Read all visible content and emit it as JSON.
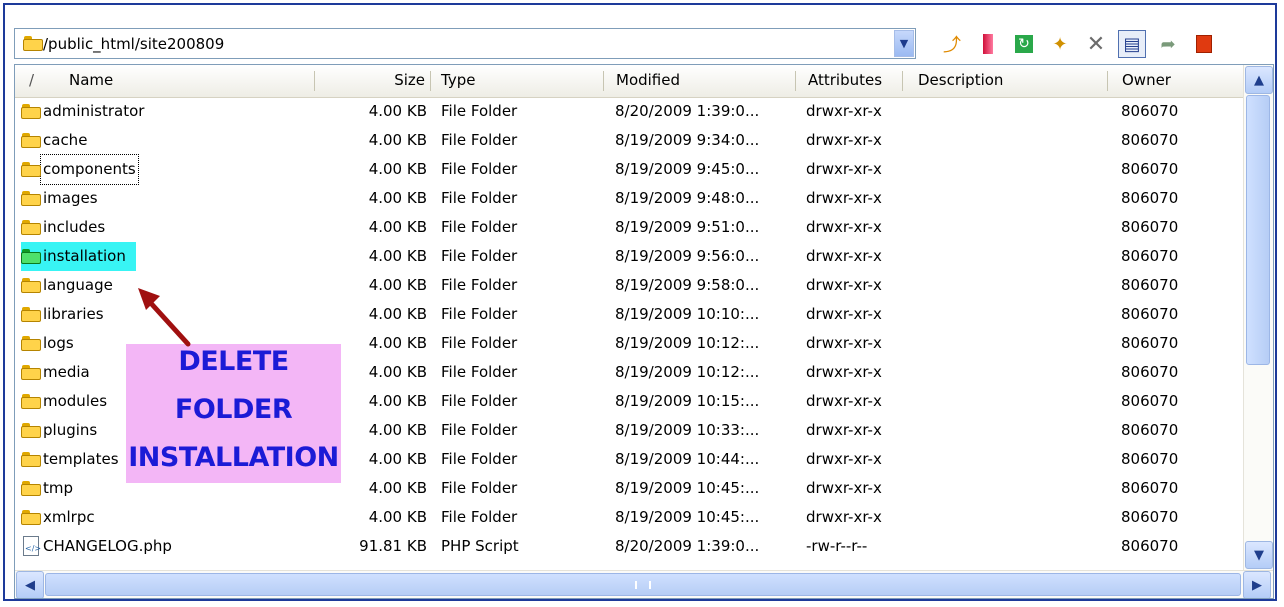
{
  "address": {
    "path": "/public_html/site200809"
  },
  "toolbar": {
    "icons": [
      "up-folder-icon",
      "bookmark-icon",
      "refresh-icon",
      "rename-icon",
      "delete-icon",
      "details-view-icon",
      "move-icon",
      "properties-icon"
    ]
  },
  "columns": {
    "sort_glyph": "/",
    "name": "Name",
    "size": "Size",
    "type": "Type",
    "modified": "Modified",
    "attributes": "Attributes",
    "description": "Description",
    "owner": "Owner"
  },
  "rows": [
    {
      "name": "administrator",
      "size": "4.00 KB",
      "type": "File Folder",
      "modified": "8/20/2009 1:39:0...",
      "attr": "drwxr-xr-x",
      "owner": "806070"
    },
    {
      "name": "cache",
      "size": "4.00 KB",
      "type": "File Folder",
      "modified": "8/19/2009 9:34:0...",
      "attr": "drwxr-xr-x",
      "owner": "806070"
    },
    {
      "name": "components",
      "size": "4.00 KB",
      "type": "File Folder",
      "modified": "8/19/2009 9:45:0...",
      "attr": "drwxr-xr-x",
      "owner": "806070"
    },
    {
      "name": "images",
      "size": "4.00 KB",
      "type": "File Folder",
      "modified": "8/19/2009 9:48:0...",
      "attr": "drwxr-xr-x",
      "owner": "806070"
    },
    {
      "name": "includes",
      "size": "4.00 KB",
      "type": "File Folder",
      "modified": "8/19/2009 9:51:0...",
      "attr": "drwxr-xr-x",
      "owner": "806070"
    },
    {
      "name": "installation",
      "size": "4.00 KB",
      "type": "File Folder",
      "modified": "8/19/2009 9:56:0...",
      "attr": "drwxr-xr-x",
      "owner": "806070"
    },
    {
      "name": "language",
      "size": "4.00 KB",
      "type": "File Folder",
      "modified": "8/19/2009 9:58:0...",
      "attr": "drwxr-xr-x",
      "owner": "806070"
    },
    {
      "name": "libraries",
      "size": "4.00 KB",
      "type": "File Folder",
      "modified": "8/19/2009 10:10:...",
      "attr": "drwxr-xr-x",
      "owner": "806070"
    },
    {
      "name": "logs",
      "size": "4.00 KB",
      "type": "File Folder",
      "modified": "8/19/2009 10:12:...",
      "attr": "drwxr-xr-x",
      "owner": "806070"
    },
    {
      "name": "media",
      "size": "4.00 KB",
      "type": "File Folder",
      "modified": "8/19/2009 10:12:...",
      "attr": "drwxr-xr-x",
      "owner": "806070"
    },
    {
      "name": "modules",
      "size": "4.00 KB",
      "type": "File Folder",
      "modified": "8/19/2009 10:15:...",
      "attr": "drwxr-xr-x",
      "owner": "806070"
    },
    {
      "name": "plugins",
      "size": "4.00 KB",
      "type": "File Folder",
      "modified": "8/19/2009 10:33:...",
      "attr": "drwxr-xr-x",
      "owner": "806070"
    },
    {
      "name": "templates",
      "size": "4.00 KB",
      "type": "File Folder",
      "modified": "8/19/2009 10:44:...",
      "attr": "drwxr-xr-x",
      "owner": "806070"
    },
    {
      "name": "tmp",
      "size": "4.00 KB",
      "type": "File Folder",
      "modified": "8/19/2009 10:45:...",
      "attr": "drwxr-xr-x",
      "owner": "806070"
    },
    {
      "name": "xmlrpc",
      "size": "4.00 KB",
      "type": "File Folder",
      "modified": "8/19/2009 10:45:...",
      "attr": "drwxr-xr-x",
      "owner": "806070"
    },
    {
      "name": "CHANGELOG.php",
      "size": "91.81 KB",
      "type": "PHP Script",
      "modified": "8/20/2009 1:39:0...",
      "attr": "-rw-r--r--",
      "owner": "806070"
    }
  ],
  "annotation": {
    "line1": "DELETE",
    "line2": "FOLDER",
    "line3": "INSTALLATION"
  },
  "colors": {
    "highlight": "#38f4f4",
    "annotation_bg": "#f3b6f6",
    "annotation_text": "#1b1bd6",
    "arrow": "#a01010"
  }
}
